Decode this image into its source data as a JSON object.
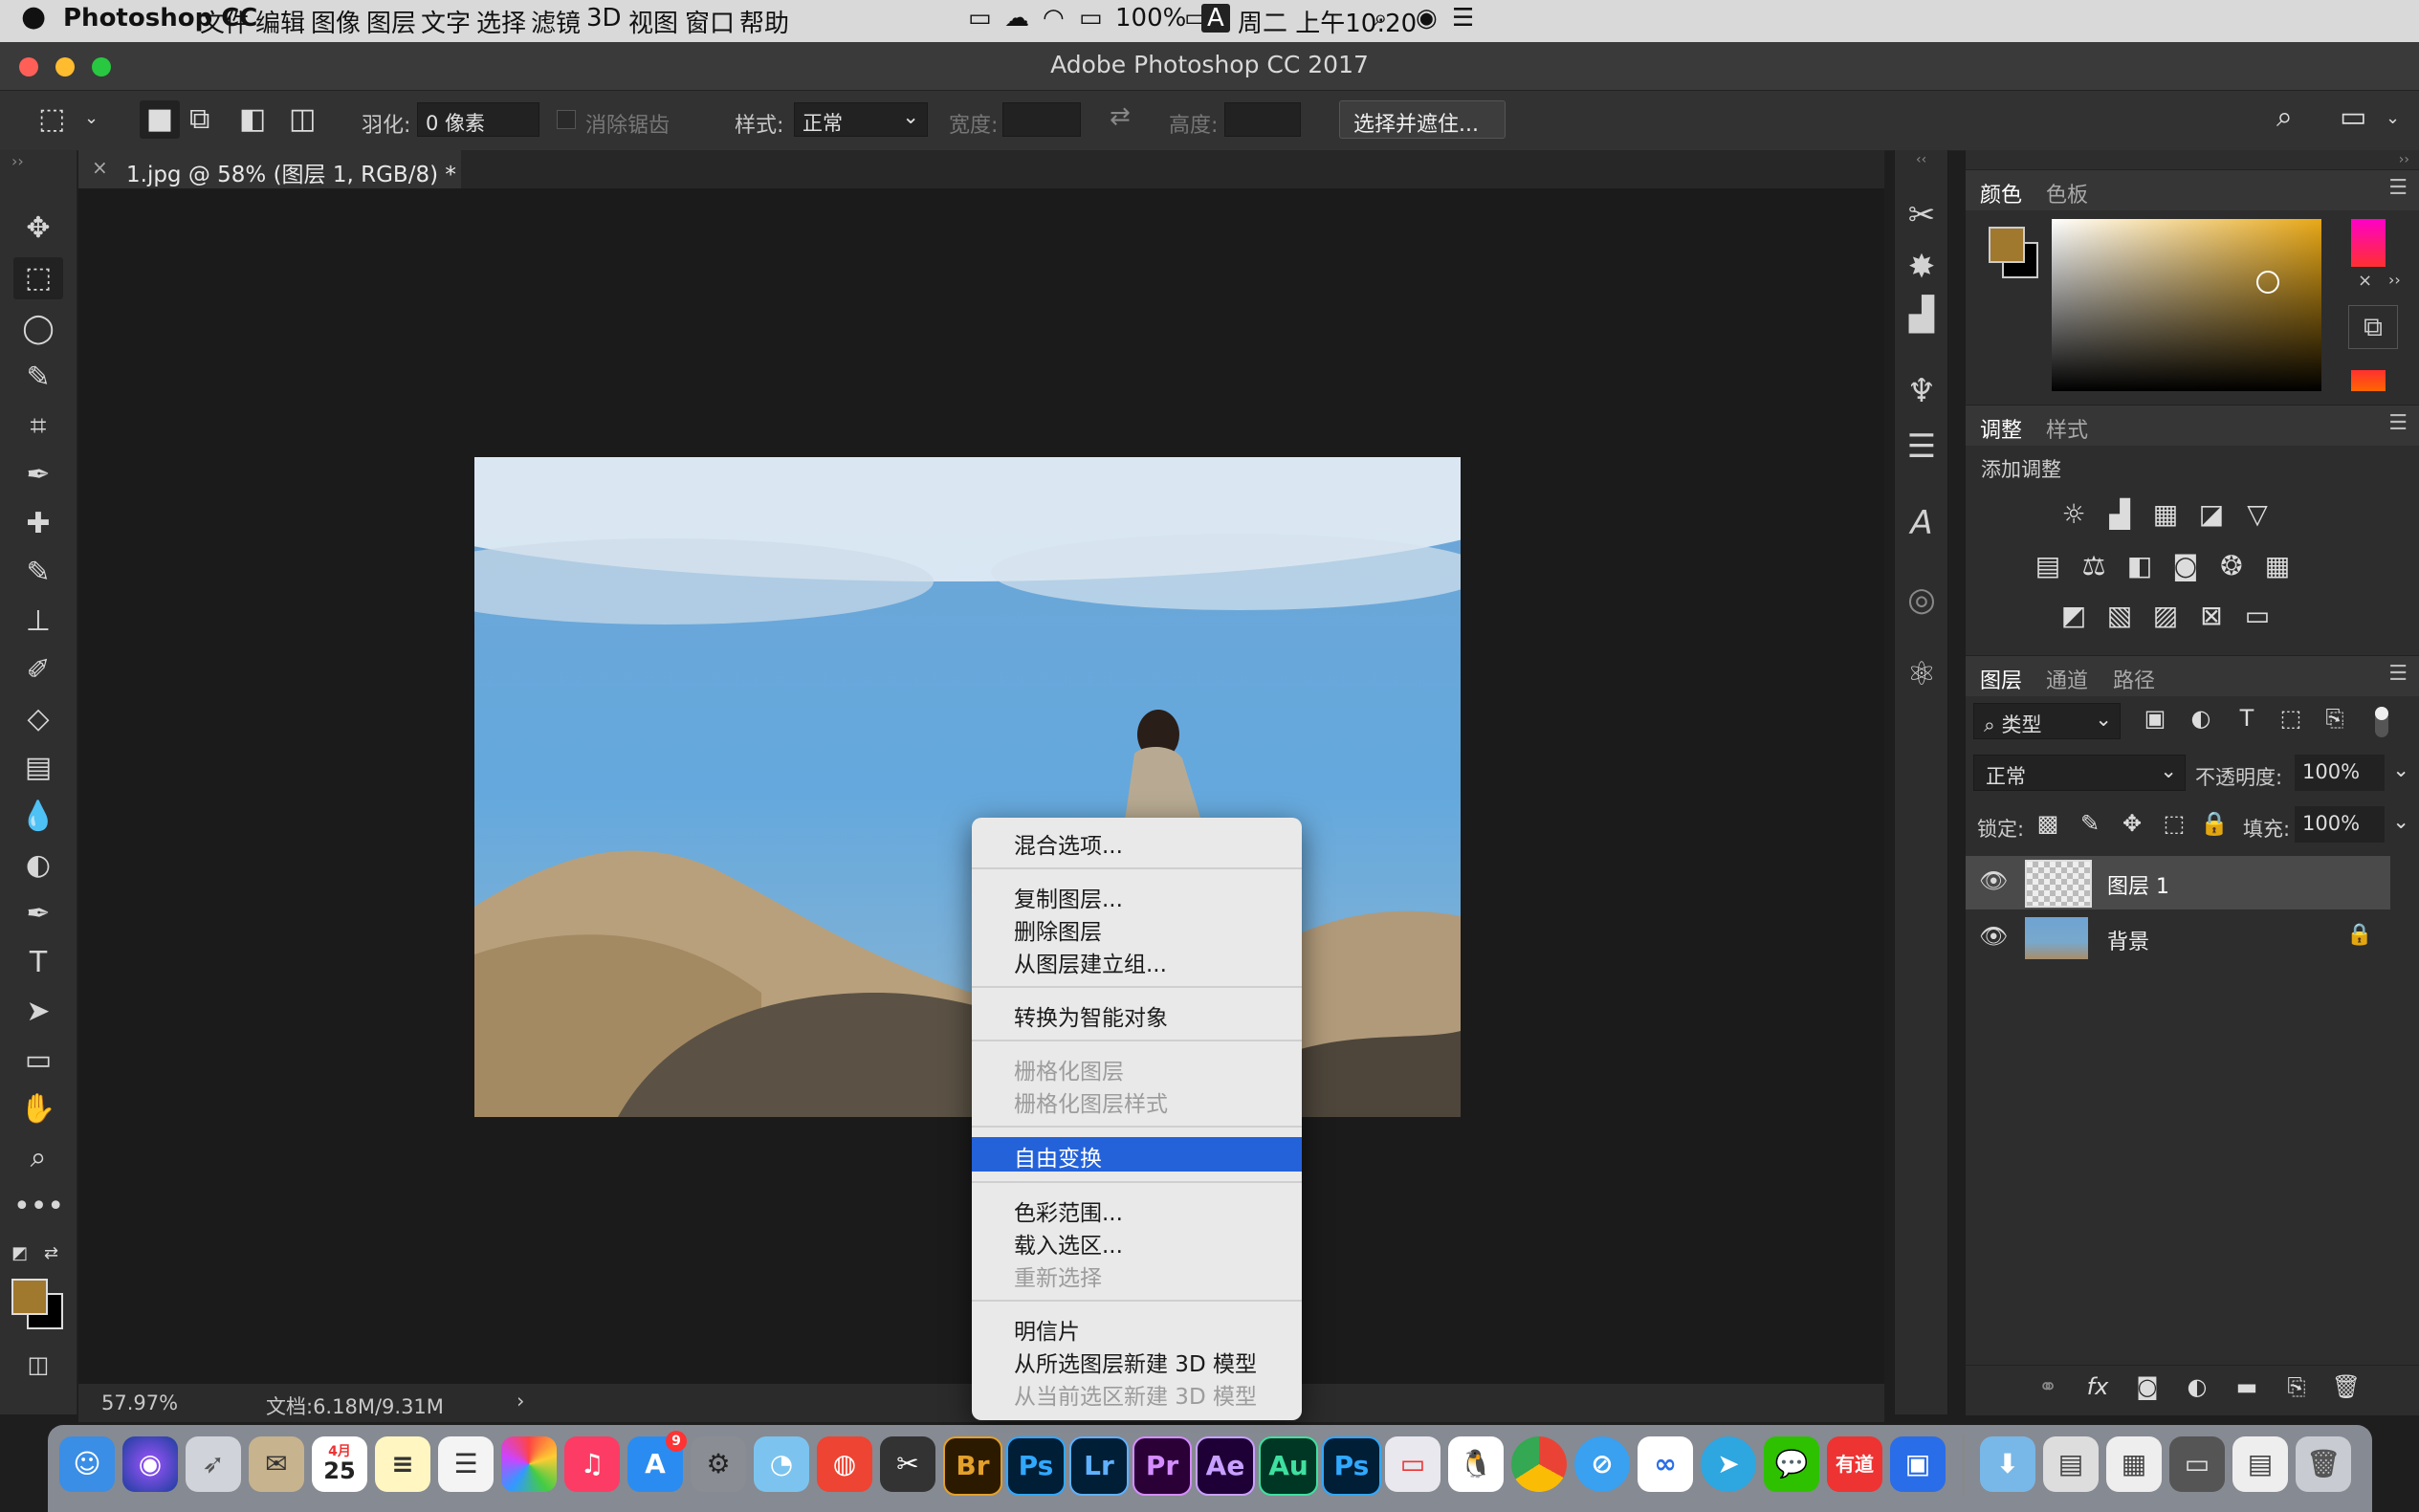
{
  "menubar": {
    "apple": "",
    "app_name": "Photoshop CC",
    "items": [
      "文件",
      "编辑",
      "图像",
      "图层",
      "文字",
      "选择",
      "滤镜",
      "3D",
      "视图",
      "窗口",
      "帮助"
    ],
    "battery": "100%",
    "input_method": "A",
    "datetime": "周二 上午10:20"
  },
  "window": {
    "title": "Adobe Photoshop CC 2017"
  },
  "options": {
    "feather_label": "羽化:",
    "feather_value": "0 像素",
    "antialias_label": "消除锯齿",
    "style_label": "样式:",
    "style_value": "正常",
    "width_label": "宽度:",
    "height_label": "高度:",
    "select_mask_button": "选择并遮住..."
  },
  "document": {
    "tab_title": "1.jpg @ 58% (图层 1, RGB/8) *",
    "zoom": "57.97%",
    "doc_size": "文档:6.18M/9.31M"
  },
  "panels": {
    "color_tabs": [
      "颜色",
      "色板"
    ],
    "adjust_tabs": [
      "调整",
      "样式"
    ],
    "add_adjustment": "添加调整",
    "layers_tabs": [
      "图层",
      "通道",
      "路径"
    ],
    "filter_kind": "类型",
    "blend_mode": "正常",
    "opacity_label": "不透明度:",
    "opacity_value": "100%",
    "lock_label": "锁定:",
    "fill_label": "填充:",
    "fill_value": "100%",
    "foreground_color": "#a0782e",
    "layers": [
      {
        "name": "图层 1",
        "selected": true
      },
      {
        "name": "背景",
        "locked": true
      }
    ]
  },
  "context_menu": {
    "groups": [
      [
        "混合选项..."
      ],
      [
        "复制图层...",
        "删除图层",
        "从图层建立组..."
      ],
      [
        "转换为智能对象"
      ],
      [
        "栅格化图层",
        "栅格化图层样式"
      ],
      [
        "自由变换"
      ],
      [
        "色彩范围...",
        "载入选区...",
        "重新选择"
      ],
      [
        "明信片",
        "从所选图层新建 3D 模型",
        "从当前选区新建 3D 模型"
      ]
    ],
    "highlighted": "自由变换",
    "disabled": [
      "栅格化图层",
      "栅格化图层样式",
      "重新选择",
      "从当前选区新建 3D 模型"
    ]
  },
  "dock": {
    "calendar_month": "4月",
    "calendar_day": "25",
    "appstore_badge": "9",
    "apps": [
      "Br",
      "Ps",
      "Lr",
      "Pr",
      "Ae",
      "Au",
      "Ps",
      "有道"
    ]
  }
}
